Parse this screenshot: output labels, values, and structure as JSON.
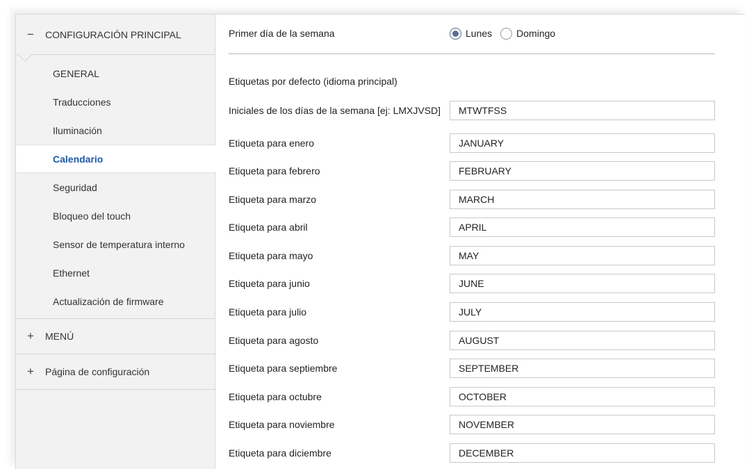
{
  "sidebar": {
    "main_group": {
      "toggle": "−",
      "label": "CONFIGURACIÓN PRINCIPAL"
    },
    "items": [
      {
        "label": "GENERAL",
        "name": "sidebar-item-general"
      },
      {
        "label": "Traducciones",
        "name": "sidebar-item-traducciones"
      },
      {
        "label": "Iluminación",
        "name": "sidebar-item-iluminacion"
      },
      {
        "label": "Calendario",
        "name": "sidebar-item-calendario"
      },
      {
        "label": "Seguridad",
        "name": "sidebar-item-seguridad"
      },
      {
        "label": "Bloqueo del touch",
        "name": "sidebar-item-bloqueo-touch"
      },
      {
        "label": "Sensor de temperatura interno",
        "name": "sidebar-item-sensor-temperatura"
      },
      {
        "label": "Ethernet",
        "name": "sidebar-item-ethernet"
      },
      {
        "label": "Actualización de firmware",
        "name": "sidebar-item-actualizacion-firmware"
      }
    ],
    "active_index": 3,
    "menu_group": {
      "toggle": "+",
      "label": "MENÚ"
    },
    "config_group": {
      "toggle": "+",
      "label": "Página de configuración"
    }
  },
  "main": {
    "first_day": {
      "label": "Primer día de la semana",
      "options": [
        "Lunes",
        "Domingo"
      ],
      "selected": "Lunes"
    },
    "section_title": "Etiquetas por defecto (idioma principal)",
    "fields": [
      {
        "label": "Iniciales de los días de la semana [ej: LMXJVSD]",
        "value": "MTWTFSS"
      },
      {
        "label": "Etiqueta para enero",
        "value": "JANUARY"
      },
      {
        "label": "Etiqueta para febrero",
        "value": "FEBRUARY"
      },
      {
        "label": "Etiqueta para marzo",
        "value": "MARCH"
      },
      {
        "label": "Etiqueta para abril",
        "value": "APRIL"
      },
      {
        "label": "Etiqueta para mayo",
        "value": "MAY"
      },
      {
        "label": "Etiqueta para junio",
        "value": "JUNE"
      },
      {
        "label": "Etiqueta para julio",
        "value": "JULY"
      },
      {
        "label": "Etiqueta para agosto",
        "value": "AUGUST"
      },
      {
        "label": "Etiqueta para septiembre",
        "value": "SEPTEMBER"
      },
      {
        "label": "Etiqueta para octubre",
        "value": "OCTOBER"
      },
      {
        "label": "Etiqueta para noviembre",
        "value": "NOVEMBER"
      },
      {
        "label": "Etiqueta para diciembre",
        "value": "DECEMBER"
      }
    ]
  },
  "colors": {
    "active_item": "#1f5aa6",
    "sidebar_bg": "#f2f2f2"
  }
}
